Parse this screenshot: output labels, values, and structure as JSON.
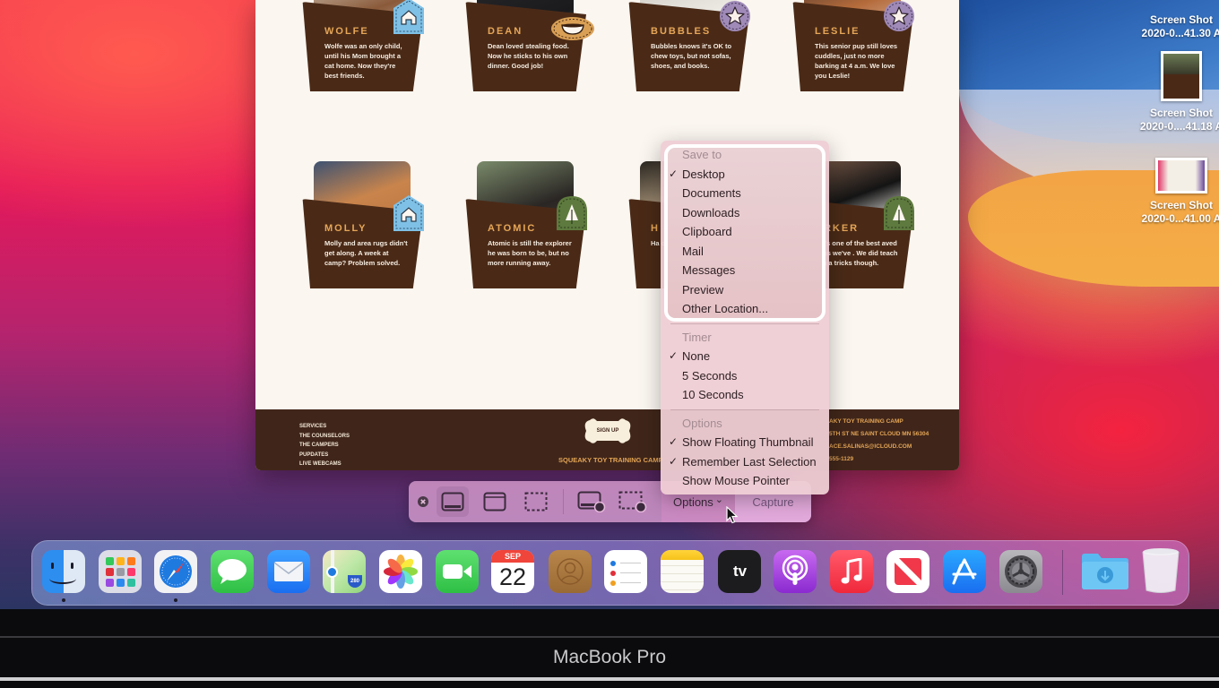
{
  "desktop": {
    "files": [
      {
        "name_line1": "Screen Shot",
        "name_line2": "2020-0...41.30 A"
      },
      {
        "name_line1": "Screen Shot",
        "name_line2": "2020-0....41.18 A"
      },
      {
        "name_line1": "Screen Shot",
        "name_line2": "2020-0...41.00 A"
      }
    ]
  },
  "webpage": {
    "campers": [
      {
        "name": "WOLFE",
        "description": "Wolfe was an only child, until his Mom brought a cat home. Now they're best friends.",
        "badge": "house-icon",
        "badge_color": "#7fc1e6"
      },
      {
        "name": "DEAN",
        "description": "Dean loved stealing food. Now he sticks to his own dinner. Good job!",
        "badge": "bowl-icon",
        "badge_color": "#d9a055"
      },
      {
        "name": "BUBBLES",
        "description": "Bubbles knows it's OK to chew toys, but not sofas, shoes, and books.",
        "badge": "star-icon",
        "badge_color": "#9f8ab8"
      },
      {
        "name": "LESLIE",
        "description": "This senior pup still loves cuddles, just no more barking at 4 a.m. We love you Leslie!",
        "badge": "star-icon",
        "badge_color": "#9f8ab8"
      },
      {
        "name": "MOLLY",
        "description": "Molly and area rugs didn't get along. A week at camp? Problem solved.",
        "badge": "house-icon",
        "badge_color": "#7fc1e6"
      },
      {
        "name": "ATOMIC",
        "description": "Atomic is still the explorer he was born to be, but no more running away.",
        "badge": "tree-icon",
        "badge_color": "#5e7a3e"
      },
      {
        "name": "H",
        "description": "Ha ca us ba",
        "badge": "none",
        "badge_color": "#4a2a17"
      },
      {
        "name": "ARKER",
        "description": "ker's one of the best aved pups we've . We did teach him a tricks though.",
        "badge": "tree-icon",
        "badge_color": "#5e7a3e"
      }
    ],
    "footer": {
      "links": [
        "SERVICES",
        "THE COUNSELORS",
        "THE CAMPERS",
        "PUPDATES",
        "LIVE WEBCAMS"
      ],
      "signup_label": "SIGN UP",
      "brand": "SQUEAKY TOY TRAINING CAMP",
      "contact": [
        "AKY TOY TRAINING CAMP",
        "5TH ST NE SAINT CLOUD MN 56304",
        "ACE.SALINAS@ICLOUD.COM",
        "555-1129"
      ]
    }
  },
  "options_menu": {
    "sections": [
      {
        "header": "Save to",
        "items": [
          {
            "label": "Desktop",
            "checked": true
          },
          {
            "label": "Documents",
            "checked": false
          },
          {
            "label": "Downloads",
            "checked": false
          },
          {
            "label": "Clipboard",
            "checked": false
          },
          {
            "label": "Mail",
            "checked": false
          },
          {
            "label": "Messages",
            "checked": false
          },
          {
            "label": "Preview",
            "checked": false
          },
          {
            "label": "Other Location...",
            "checked": false
          }
        ]
      },
      {
        "header": "Timer",
        "items": [
          {
            "label": "None",
            "checked": true
          },
          {
            "label": "5 Seconds",
            "checked": false
          },
          {
            "label": "10 Seconds",
            "checked": false
          }
        ]
      },
      {
        "header": "Options",
        "items": [
          {
            "label": "Show Floating Thumbnail",
            "checked": true
          },
          {
            "label": "Remember Last Selection",
            "checked": true
          },
          {
            "label": "Show Mouse Pointer",
            "checked": false
          }
        ]
      }
    ],
    "check_glyph": "✓"
  },
  "toolbar": {
    "close_icon": "close-icon",
    "modes": [
      "capture-entire-screen",
      "capture-selected-window",
      "capture-selected-portion",
      "record-entire-screen",
      "record-selected-portion"
    ],
    "selected_mode": "capture-entire-screen",
    "options_label": "Options",
    "options_chevron": "⌄",
    "capture_label": "Capture"
  },
  "dock": {
    "apps": [
      "Finder",
      "Launchpad",
      "Safari",
      "Messages",
      "Mail",
      "Maps",
      "Photos",
      "FaceTime",
      "Calendar",
      "Contacts",
      "Reminders",
      "Notes",
      "TV",
      "Podcasts",
      "Music",
      "News",
      "App Store",
      "System Preferences",
      "Downloads",
      "Trash"
    ],
    "running": [
      "Finder",
      "Safari"
    ],
    "calendar_month": "SEP",
    "calendar_day": "22",
    "tv_label": "tv",
    "maps_shield": "280"
  },
  "bezel": {
    "label": "MacBook Pro"
  }
}
